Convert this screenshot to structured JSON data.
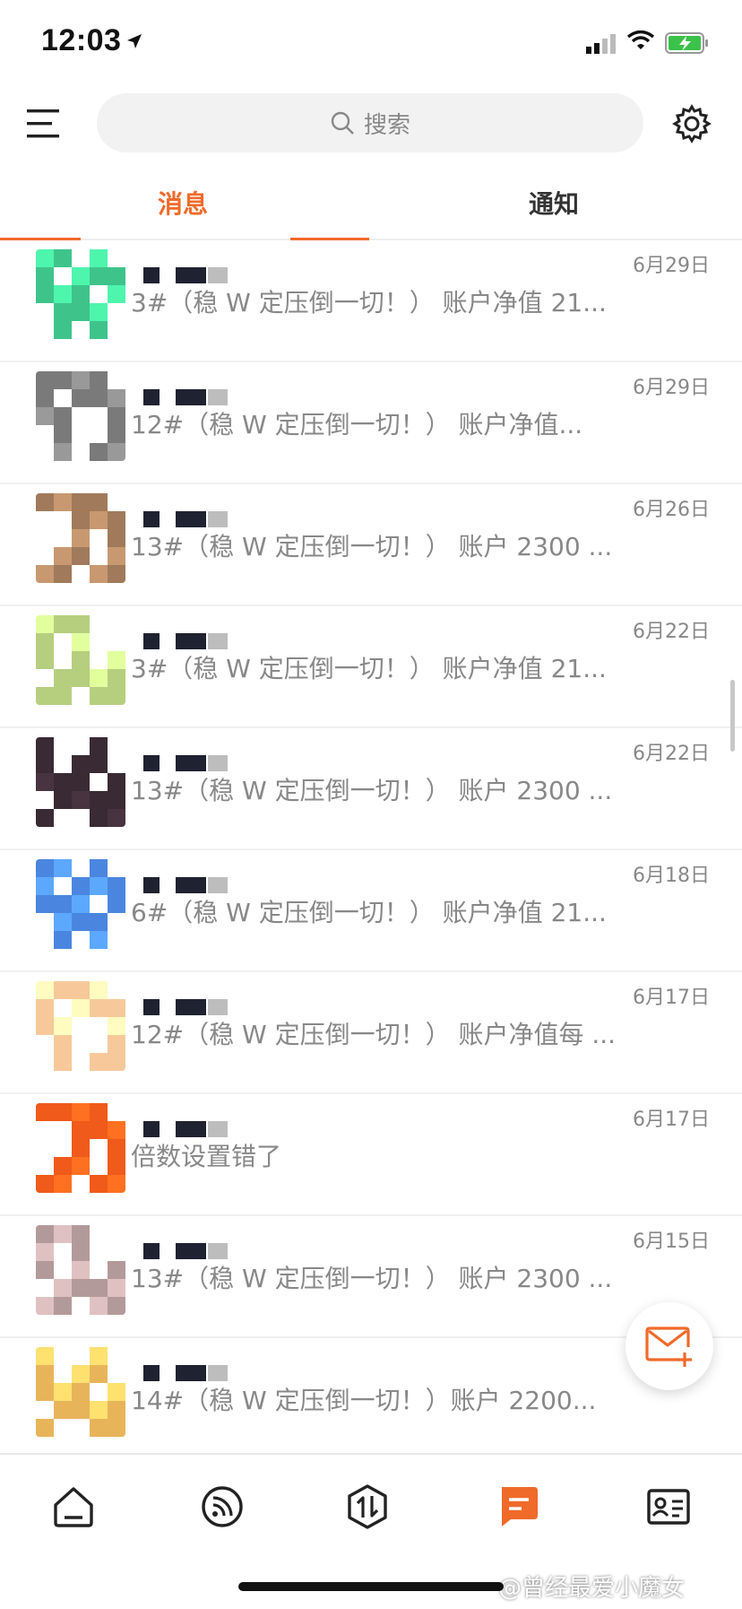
{
  "status_bar": {
    "time": "12:03"
  },
  "search": {
    "placeholder": "搜索"
  },
  "tabs": [
    {
      "label": "消息",
      "active": true
    },
    {
      "label": "通知",
      "active": false
    }
  ],
  "messages": [
    {
      "preview": "3#（稳 W 定压倒一切！） 账户净值 21...",
      "date": "6月29日",
      "avatar_color": "#3ec48a"
    },
    {
      "preview": "12#（稳 W 定压倒一切！） 账户净值...",
      "date": "6月29日",
      "avatar_color": "#7a7a7a"
    },
    {
      "preview": "13#（稳 W 定压倒一切！） 账户 2300 ...",
      "date": "6月26日",
      "avatar_color": "#a07a5a"
    },
    {
      "preview": "3#（稳 W 定压倒一切！） 账户净值 21...",
      "date": "6月22日",
      "avatar_color": "#b5cf7e"
    },
    {
      "preview": "13#（稳 W 定压倒一切！） 账户 2300 ...",
      "date": "6月22日",
      "avatar_color": "#3a2a33"
    },
    {
      "preview": "6#（稳 W 定压倒一切！） 账户净值 21...",
      "date": "6月18日",
      "avatar_color": "#4a86e0"
    },
    {
      "preview": "12#（稳 W 定压倒一切！） 账户净值每 ...",
      "date": "6月17日",
      "avatar_color": "#f7c99a"
    },
    {
      "preview": "倍数设置错了",
      "date": "6月17日",
      "avatar_color": "#f05a1a"
    },
    {
      "preview": "13#（稳 W 定压倒一切！） 账户 2300 ...",
      "date": "6月15日",
      "avatar_color": "#b39a9a"
    },
    {
      "preview": "14#（稳 W 定压倒一切！）账户 2200...",
      "date": "",
      "avatar_color": "#e8b45a"
    }
  ],
  "bottom_nav": [
    {
      "icon": "home-icon",
      "active": false
    },
    {
      "icon": "feed-icon",
      "active": false
    },
    {
      "icon": "trade-icon",
      "active": false
    },
    {
      "icon": "message-icon",
      "active": true
    },
    {
      "icon": "profile-card-icon",
      "active": false
    }
  ],
  "watermark": "@曾经最爱小魔女",
  "colors": {
    "accent": "#f06a2a",
    "text_secondary": "#888888"
  }
}
